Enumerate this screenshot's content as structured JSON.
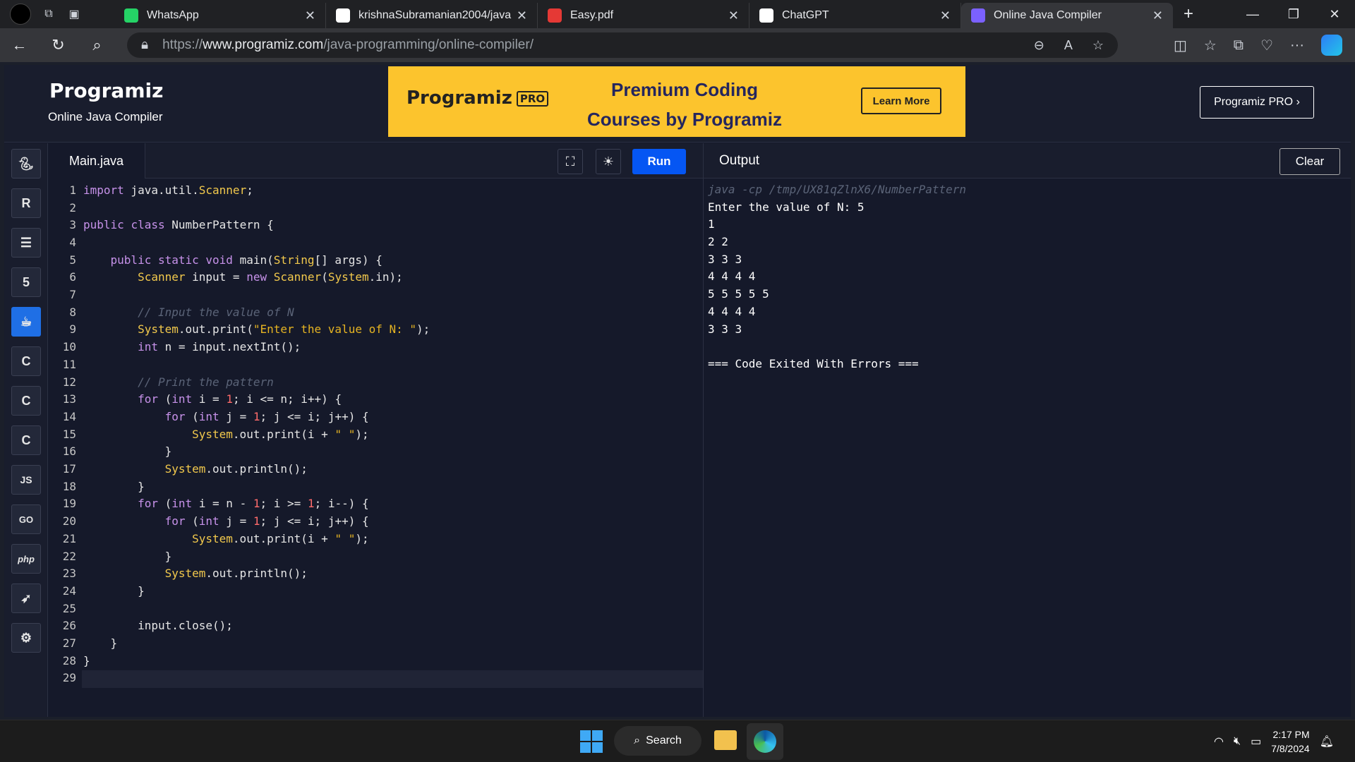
{
  "browser": {
    "tabs": [
      {
        "title": "WhatsApp",
        "icon": "whatsapp-icon",
        "color": "#25d366"
      },
      {
        "title": "krishnaSubramanian2004/java",
        "icon": "github-icon",
        "color": "#ffffff"
      },
      {
        "title": "Easy.pdf",
        "icon": "pdf-icon",
        "color": "#e53935"
      },
      {
        "title": "ChatGPT",
        "icon": "chatgpt-icon",
        "color": "#ffffff"
      },
      {
        "title": "Online Java Compiler",
        "icon": "programiz-icon",
        "color": "#7b61ff"
      }
    ],
    "url_prefix": "https://",
    "url_domain": "www.programiz.com",
    "url_path": "/java-programming/online-compiler/"
  },
  "header": {
    "logo": "Programiz",
    "subtitle": "Online Java Compiler",
    "banner_logo": "Programiz",
    "banner_pro": "PRO",
    "banner_line1": "Premium Coding",
    "banner_line2": "Courses by Programiz",
    "learn_more": "Learn More",
    "pro_button": "Programiz PRO ›"
  },
  "sidebar": {
    "items": [
      "python",
      "r",
      "sql",
      "html",
      "java",
      "c",
      "cpp",
      "csharp",
      "JS",
      "GO",
      "php",
      "swift",
      "rust"
    ]
  },
  "editor": {
    "filename": "Main.java",
    "run_label": "Run",
    "lines": [
      "import java.util.Scanner;",
      "",
      "public class NumberPattern {",
      "",
      "    public static void main(String[] args) {",
      "        Scanner input = new Scanner(System.in);",
      "",
      "        // Input the value of N",
      "        System.out.print(\"Enter the value of N: \");",
      "        int n = input.nextInt();",
      "",
      "        // Print the pattern",
      "        for (int i = 1; i <= n; i++) {",
      "            for (int j = 1; j <= i; j++) {",
      "                System.out.print(i + \" \");",
      "            }",
      "            System.out.println();",
      "        }",
      "        for (int i = n - 1; i >= 1; i--) {",
      "            for (int j = 1; j <= i; j++) {",
      "                System.out.print(i + \" \");",
      "            }",
      "            System.out.println();",
      "        }",
      "",
      "        input.close();",
      "    }",
      "}",
      ""
    ]
  },
  "output": {
    "title": "Output",
    "clear_label": "Clear",
    "command": "java -cp /tmp/UX81qZlnX6/NumberPattern",
    "lines": [
      "Enter the value of N: 5",
      "1",
      "2 2",
      "3 3 3",
      "4 4 4 4",
      "5 5 5 5 5",
      "4 4 4 4",
      "3 3 3",
      "",
      "=== Code Exited With Errors ==="
    ]
  },
  "taskbar": {
    "search_label": "Search",
    "time": "2:17 PM",
    "date": "7/8/2024"
  }
}
